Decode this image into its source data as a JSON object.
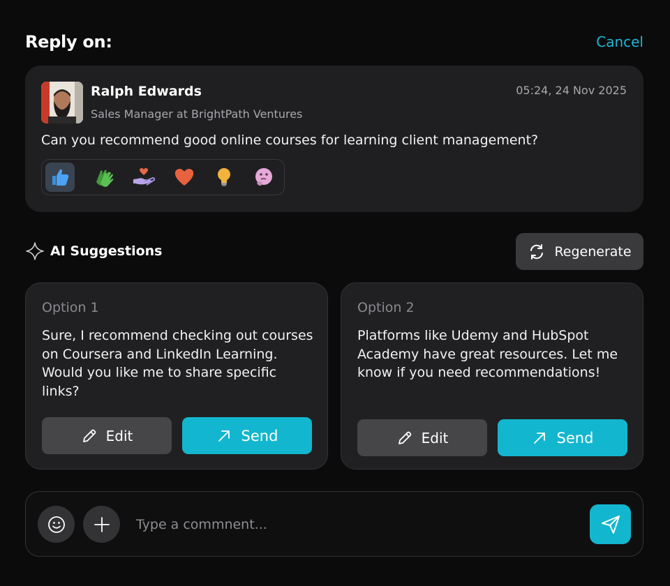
{
  "header": {
    "title": "Reply on:",
    "cancel_label": "Cancel"
  },
  "post": {
    "author": "Ralph Edwards",
    "role": "Sales Manager at BrightPath Ventures",
    "timestamp": "05:24, 24 Nov 2025",
    "text": "Can you recommend good online courses for learning client management?",
    "reactions": [
      {
        "icon": "thumbs-up-icon",
        "active": true
      },
      {
        "icon": "clapping-hands-icon",
        "active": false
      },
      {
        "icon": "heart-hand-icon",
        "active": false
      },
      {
        "icon": "heart-icon",
        "active": false
      },
      {
        "icon": "lightbulb-icon",
        "active": false
      },
      {
        "icon": "thinking-face-icon",
        "active": false
      }
    ]
  },
  "ai": {
    "label": "AI Suggestions",
    "regenerate_label": "Regenerate"
  },
  "options": [
    {
      "title": "Option 1",
      "text": "Sure, I recommend checking out courses on Coursera and LinkedIn Learning. Would you like me to share specific links?",
      "edit_label": "Edit",
      "send_label": "Send"
    },
    {
      "title": "Option 2",
      "text": "Platforms like Udemy and HubSpot Academy have great resources. Let me know if you need recommendations!",
      "edit_label": "Edit",
      "send_label": "Send"
    }
  ],
  "composer": {
    "placeholder": "Type a commnent..."
  },
  "colors": {
    "accent": "#13b6cf",
    "cancel": "#1fb6d4",
    "background": "#0b0b0c",
    "card": "#1f1f21"
  }
}
